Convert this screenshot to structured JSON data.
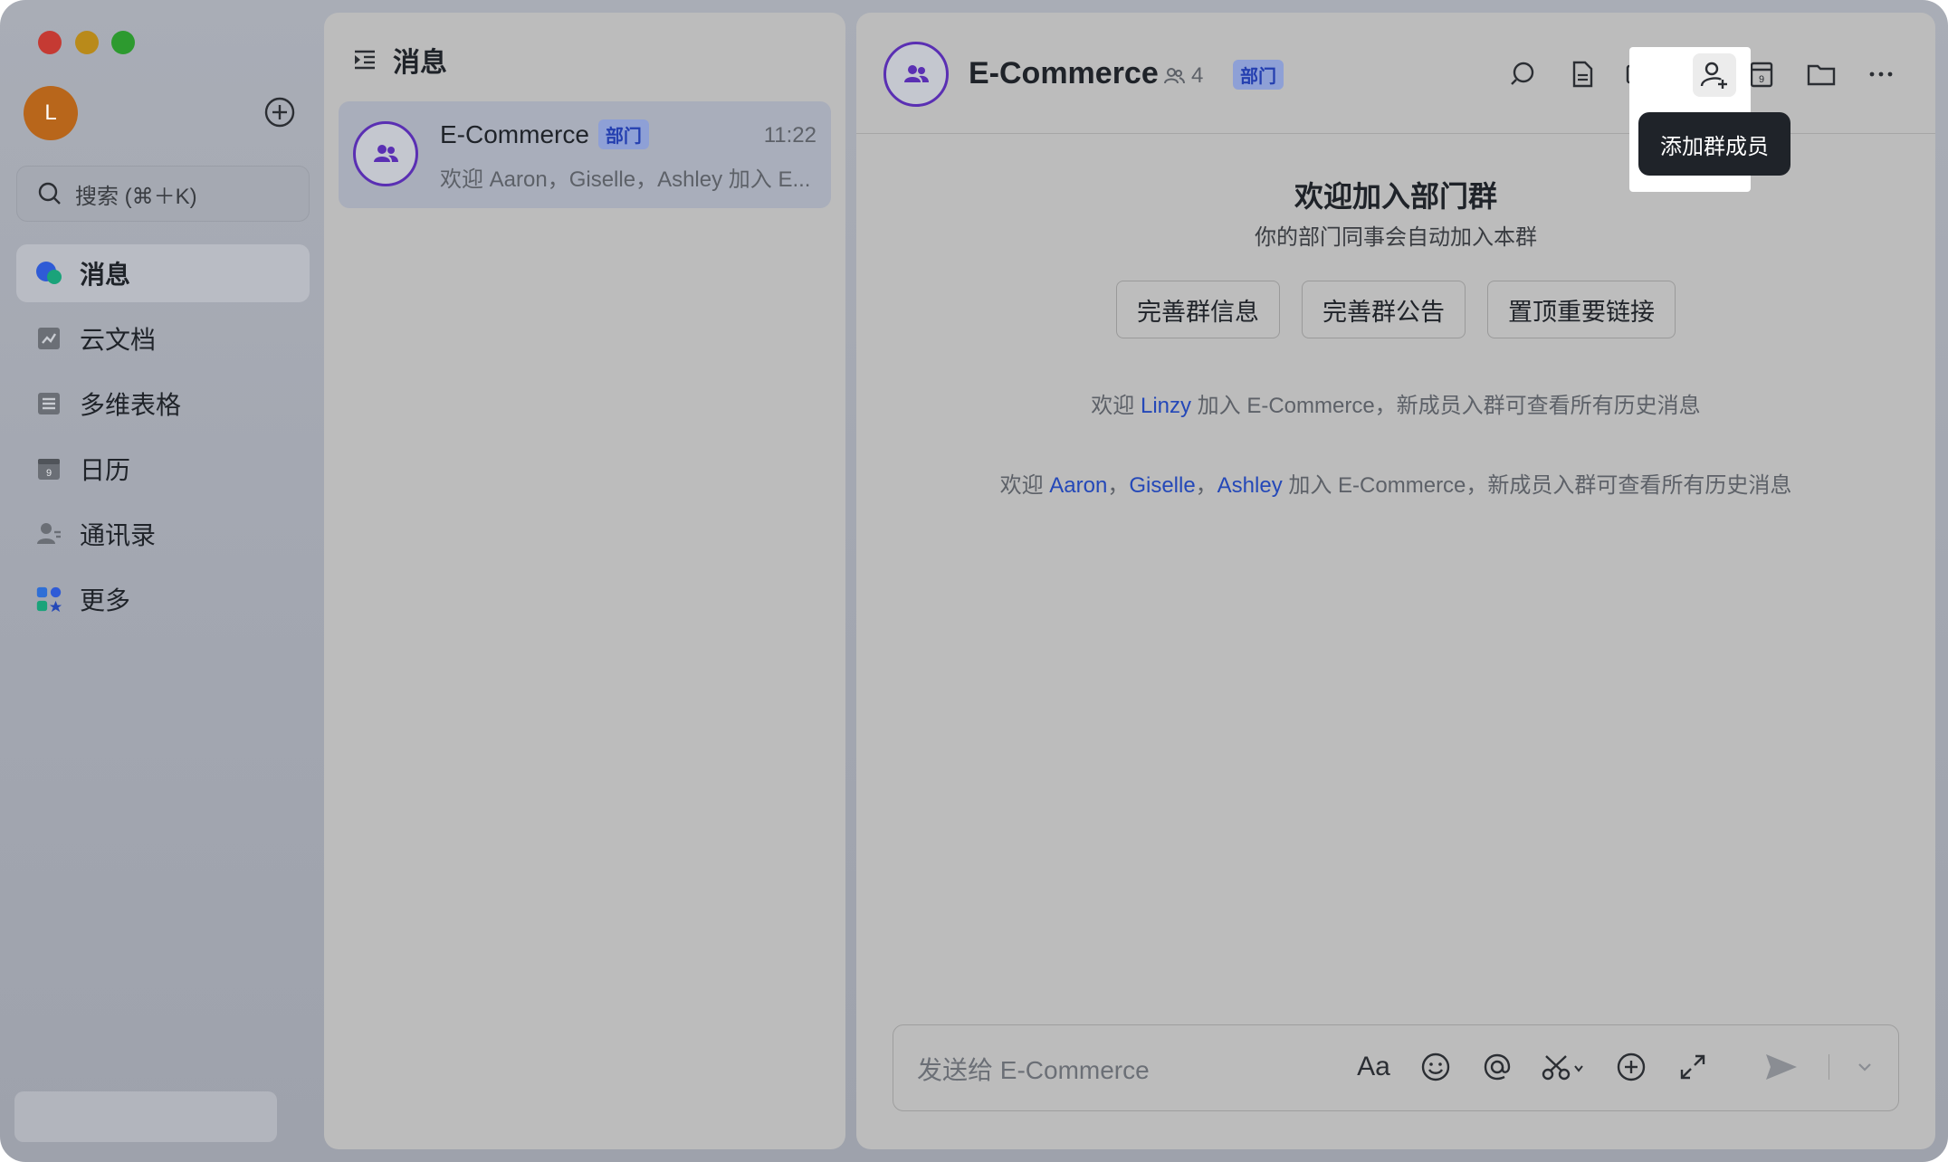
{
  "sidebar": {
    "avatar_initial": "L",
    "search_placeholder": "搜索 (⌘＋K)",
    "items": [
      {
        "label": "消息",
        "icon": "messages-icon"
      },
      {
        "label": "云文档",
        "icon": "docs-icon"
      },
      {
        "label": "多维表格",
        "icon": "base-icon"
      },
      {
        "label": "日历",
        "icon": "calendar-icon"
      },
      {
        "label": "通讯录",
        "icon": "contacts-icon"
      },
      {
        "label": "更多",
        "icon": "more-apps-icon"
      }
    ]
  },
  "list": {
    "title": "消息",
    "chat": {
      "name": "E-Commerce",
      "tag": "部门",
      "time": "11:22",
      "preview": "欢迎 Aaron，Giselle，Ashley 加入 E..."
    }
  },
  "chat": {
    "title": "E-Commerce",
    "member_count": "4",
    "tag": "部门",
    "tooltip": "添加群成员",
    "welcome_title": "欢迎加入部门群",
    "welcome_sub": "你的部门同事会自动加入本群",
    "actions": [
      "完善群信息",
      "完善群公告",
      "置顶重要链接"
    ],
    "sys1": {
      "prefix": "欢迎 ",
      "name": "Linzy",
      "suffix": " 加入 E-Commerce，新成员入群可查看所有历史消息"
    },
    "sys2": {
      "prefix": "欢迎 ",
      "names": [
        "Aaron",
        "Giselle",
        "Ashley"
      ],
      "sep": "，",
      "suffix": " 加入 E-Commerce，新成员入群可查看所有历史消息"
    },
    "composer_placeholder": "发送给 E-Commerce",
    "font_button": "Aa"
  },
  "colors": {
    "accent": "#5a2fb3",
    "link": "#2448b8",
    "tooltip_bg": "#1f2329"
  }
}
